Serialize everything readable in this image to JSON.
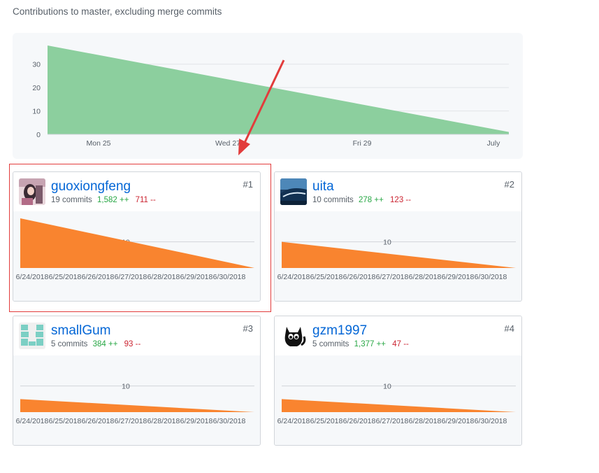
{
  "header": {
    "caption": "Contributions to master, excluding merge commits"
  },
  "chart_data": [
    {
      "type": "area",
      "title": "",
      "x_labels": [
        "Mon 25",
        "Wed 27",
        "Fri 29",
        "July"
      ],
      "yticks": [
        0,
        10,
        20,
        30
      ],
      "ylim": [
        0,
        38
      ],
      "series": [
        {
          "values": [
            38,
            1
          ]
        }
      ],
      "color": "#8ccf9e"
    }
  ],
  "contributors": [
    {
      "rank": "#1",
      "username": "guoxiongfeng",
      "commits": "19 commits",
      "additions": "1,582 ++",
      "deletions": "711 --",
      "avatar": "photo-avatar",
      "chart": {
        "type": "area",
        "ytick": "10",
        "start": 19,
        "end": 0,
        "ymax": 19,
        "x_labels": [
          "6/24/2018",
          "6/25/2018",
          "6/26/2018",
          "6/27/2018",
          "6/28/2018",
          "6/29/2018",
          "6/30/2018"
        ]
      }
    },
    {
      "rank": "#2",
      "username": "uita",
      "commits": "10 commits",
      "additions": "278 ++",
      "deletions": "123 --",
      "avatar": "landscape-avatar",
      "chart": {
        "type": "area",
        "ytick": "10",
        "start": 10,
        "end": 0,
        "ymax": 19,
        "x_labels": [
          "6/24/2018",
          "6/25/2018",
          "6/26/2018",
          "6/27/2018",
          "6/28/2018",
          "6/29/2018",
          "6/30/2018"
        ]
      }
    },
    {
      "rank": "#3",
      "username": "smallGum",
      "commits": "5 commits",
      "additions": "384 ++",
      "deletions": "93 --",
      "avatar": "identicon-avatar",
      "chart": {
        "type": "area",
        "ytick": "10",
        "start": 5,
        "end": 0,
        "ymax": 19,
        "x_labels": [
          "6/24/2018",
          "6/25/2018",
          "6/26/2018",
          "6/27/2018",
          "6/28/2018",
          "6/29/2018",
          "6/30/2018"
        ]
      }
    },
    {
      "rank": "#4",
      "username": "gzm1997",
      "commits": "5 commits",
      "additions": "1,377 ++",
      "deletions": "47 --",
      "avatar": "cat-avatar",
      "chart": {
        "type": "area",
        "ytick": "10",
        "start": 5,
        "end": 0,
        "ymax": 19,
        "x_labels": [
          "6/24/2018",
          "6/25/2018",
          "6/26/2018",
          "6/27/2018",
          "6/28/2018",
          "6/29/2018",
          "6/30/2018"
        ]
      }
    }
  ],
  "colors": {
    "main_area": "#8ccf9e",
    "contrib_area": "#f9842f",
    "link": "#0366d6",
    "additions": "#28a745",
    "deletions": "#cb2431",
    "annotation": "#e23c3c"
  }
}
